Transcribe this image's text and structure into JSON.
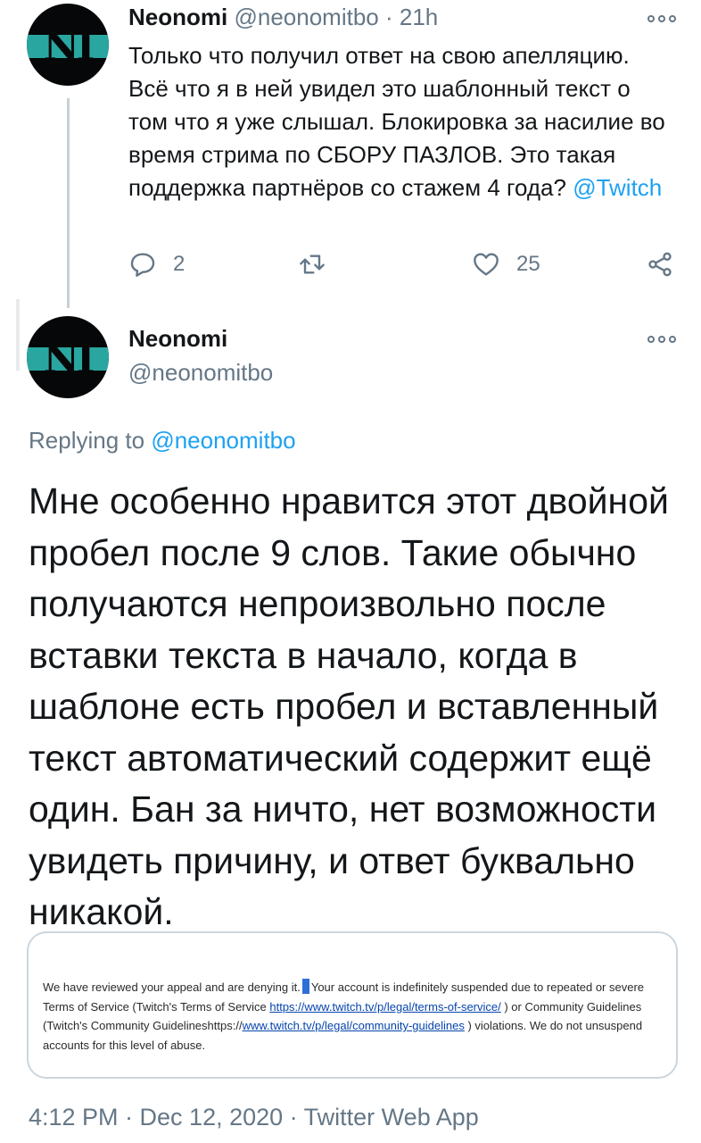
{
  "tweet1": {
    "author_name": "Neonomi",
    "author_handle": "@neonomitbo",
    "separator": "·",
    "time": "21h",
    "text": "Только что получил ответ на свою апелляцию. Всё что я в ней увидел это шаблонный текст о том что я уже слышал. Блокировка за насилие во время стрима по СБОРУ ПАЗЛОВ. Это такая поддержка партнёров со стажем 4 года?",
    "mention": "@Twitch",
    "replies": "2",
    "likes": "25"
  },
  "tweet2": {
    "author_name": "Neonomi",
    "author_handle": "@neonomitbo",
    "replying_label": "Replying to",
    "replying_handle": "@neonomitbo",
    "text": "Мне особенно нравится этот двойной пробел после 9 слов. Такие обычно получаются непроизвольно после вставки текста в начало, когда в шаблоне есть пробел и вставленный текст автоматический содержит ещё один. Бан за ничто, нет возможности увидеть причину, и ответ буквально никакой.",
    "embed": {
      "part1": "We have reviewed your appeal and are denying it.",
      "part2": "Your account is indefinitely suspended due to repeated or severe Terms of Service (Twitch's Terms of Service",
      "link1": "https://www.twitch.tv/p/legal/terms-of-service/",
      "part3": ") or Community Guidelines (Twitch's Community Guidelineshttps://",
      "link2": "www.twitch.tv/p/legal/community-guidelines",
      "part4": ") violations. We do not unsuspend accounts for this level of abuse."
    },
    "footer": "4:12 PM · Dec 12, 2020 · Twitter Web App"
  },
  "colors": {
    "link": "#1da1f2",
    "muted": "#657786",
    "avatar_accent": "#2aa6a0"
  }
}
